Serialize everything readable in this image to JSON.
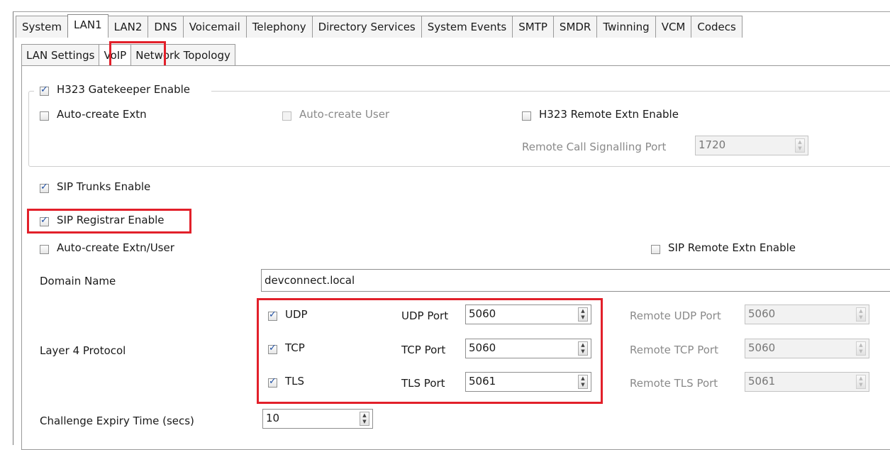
{
  "tabs": [
    "System",
    "LAN1",
    "LAN2",
    "DNS",
    "Voicemail",
    "Telephony",
    "Directory Services",
    "System Events",
    "SMTP",
    "SMDR",
    "Twinning",
    "VCM",
    "Codecs"
  ],
  "subtabs": [
    "LAN Settings",
    "VoIP",
    "Network Topology"
  ],
  "h323": {
    "gatekeeper_label": "H323 Gatekeeper Enable",
    "auto_create_extn_label": "Auto-create Extn",
    "auto_create_user_label": "Auto-create User",
    "remote_extn_label": "H323 Remote Extn Enable",
    "remote_call_port_label": "Remote Call Signalling Port",
    "remote_call_port_value": "1720"
  },
  "sip": {
    "trunks_label": "SIP Trunks Enable",
    "registrar_label": "SIP Registrar Enable",
    "auto_create_label": "Auto-create Extn/User",
    "remote_extn_label": "SIP Remote Extn Enable",
    "domain_label": "Domain Name",
    "domain_value": "devconnect.local",
    "layer4_label": "Layer 4 Protocol",
    "udp_label": "UDP",
    "tcp_label": "TCP",
    "tls_label": "TLS",
    "udp_port_label": "UDP Port",
    "tcp_port_label": "TCP Port",
    "tls_port_label": "TLS Port",
    "udp_port_value": "5060",
    "tcp_port_value": "5060",
    "tls_port_value": "5061",
    "remote_udp_label": "Remote UDP Port",
    "remote_tcp_label": "Remote TCP Port",
    "remote_tls_label": "Remote TLS Port",
    "remote_udp_value": "5060",
    "remote_tcp_value": "5060",
    "remote_tls_value": "5061",
    "challenge_label": "Challenge Expiry Time (secs)",
    "challenge_value": "10"
  },
  "colors": {
    "highlight": "#e2202a",
    "check": "#1f4fa3"
  }
}
